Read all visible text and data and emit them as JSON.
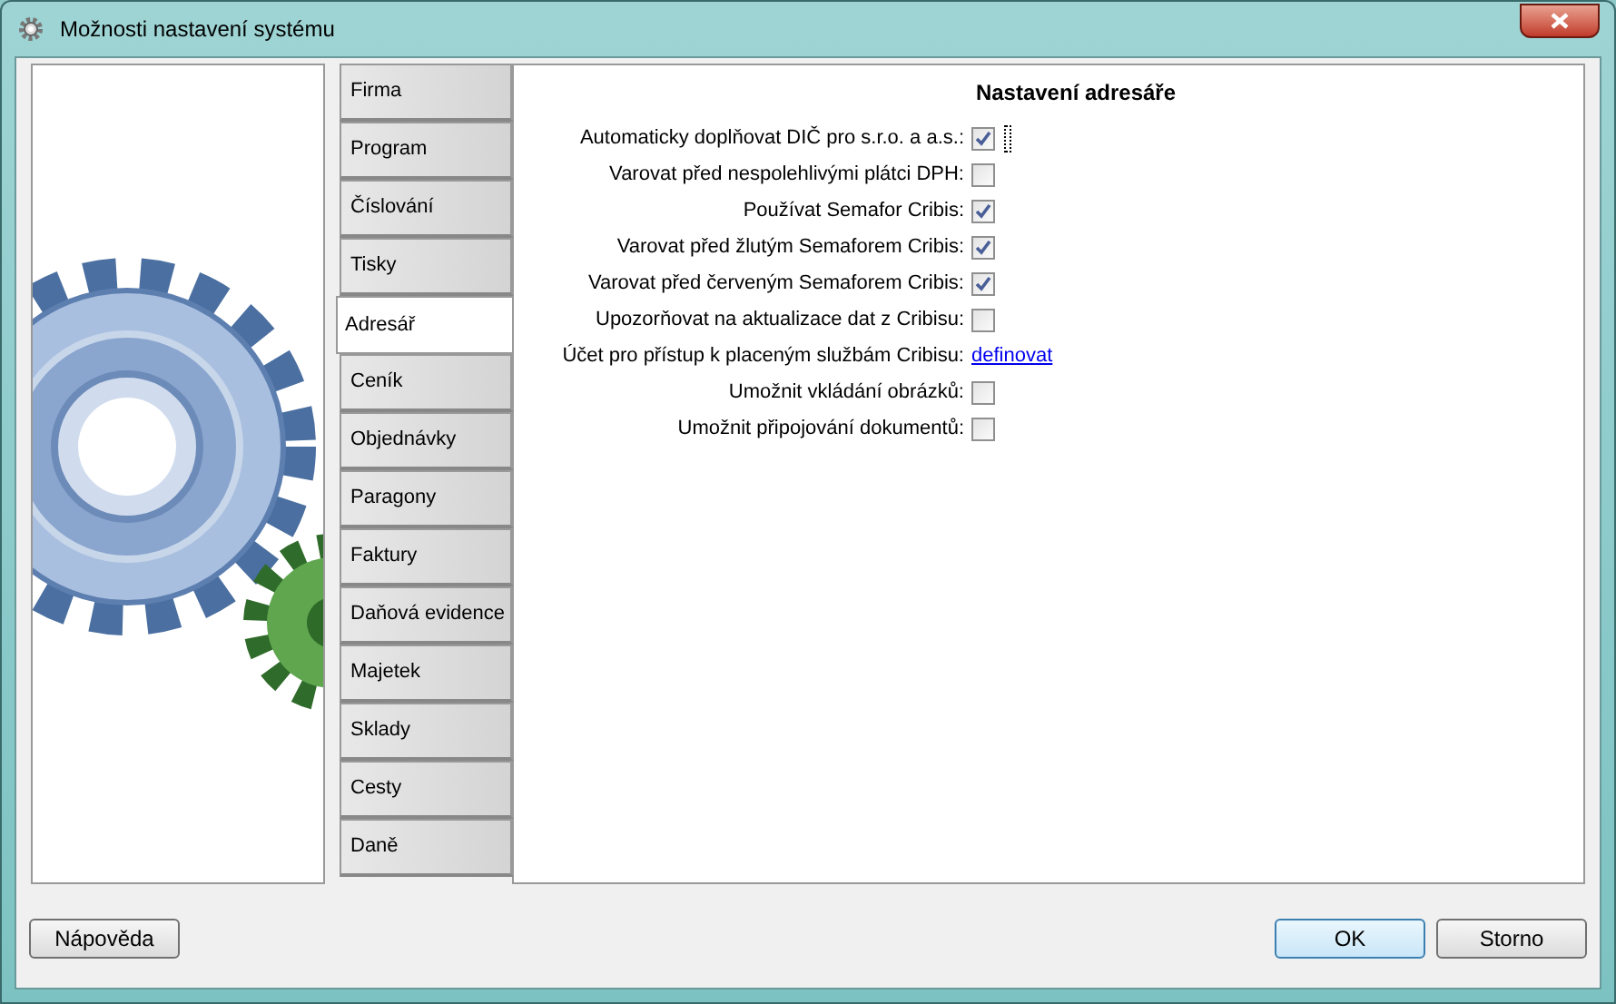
{
  "window": {
    "title": "Možnosti nastavení systému"
  },
  "tabs": [
    {
      "label": "Firma",
      "selected": false
    },
    {
      "label": "Program",
      "selected": false
    },
    {
      "label": "Číslování",
      "selected": false
    },
    {
      "label": "Tisky",
      "selected": false
    },
    {
      "label": "Adresář",
      "selected": true
    },
    {
      "label": "Ceník",
      "selected": false
    },
    {
      "label": "Objednávky",
      "selected": false
    },
    {
      "label": "Paragony",
      "selected": false
    },
    {
      "label": "Faktury",
      "selected": false
    },
    {
      "label": "Daňová evidence",
      "selected": false
    },
    {
      "label": "Majetek",
      "selected": false
    },
    {
      "label": "Sklady",
      "selected": false
    },
    {
      "label": "Cesty",
      "selected": false
    },
    {
      "label": "Daně",
      "selected": false
    }
  ],
  "panel": {
    "title": "Nastavení adresáře",
    "rows": [
      {
        "kind": "checkbox",
        "label": "Automaticky doplňovat DIČ pro s.r.o. a a.s.:",
        "checked": true,
        "focused": true
      },
      {
        "kind": "checkbox",
        "label": "Varovat před nespolehlivými plátci DPH:",
        "checked": false,
        "focused": false
      },
      {
        "kind": "checkbox",
        "label": "Používat Semafor Cribis:",
        "checked": true,
        "focused": false
      },
      {
        "kind": "checkbox",
        "label": "Varovat před žlutým Semaforem Cribis:",
        "checked": true,
        "focused": false
      },
      {
        "kind": "checkbox",
        "label": "Varovat před červeným Semaforem Cribis:",
        "checked": true,
        "focused": false
      },
      {
        "kind": "checkbox",
        "label": "Upozorňovat na aktualizace dat z Cribisu:",
        "checked": false,
        "focused": false
      },
      {
        "kind": "link",
        "label": "Účet pro přístup k placeným službám Cribisu:",
        "link": "definovat"
      },
      {
        "kind": "checkbox",
        "label": "Umožnit vkládání obrázků:",
        "checked": false,
        "focused": false
      },
      {
        "kind": "checkbox",
        "label": "Umožnit připojování dokumentů:",
        "checked": false,
        "focused": false
      }
    ]
  },
  "buttons": {
    "help": "Nápověda",
    "ok": "OK",
    "cancel": "Storno"
  }
}
